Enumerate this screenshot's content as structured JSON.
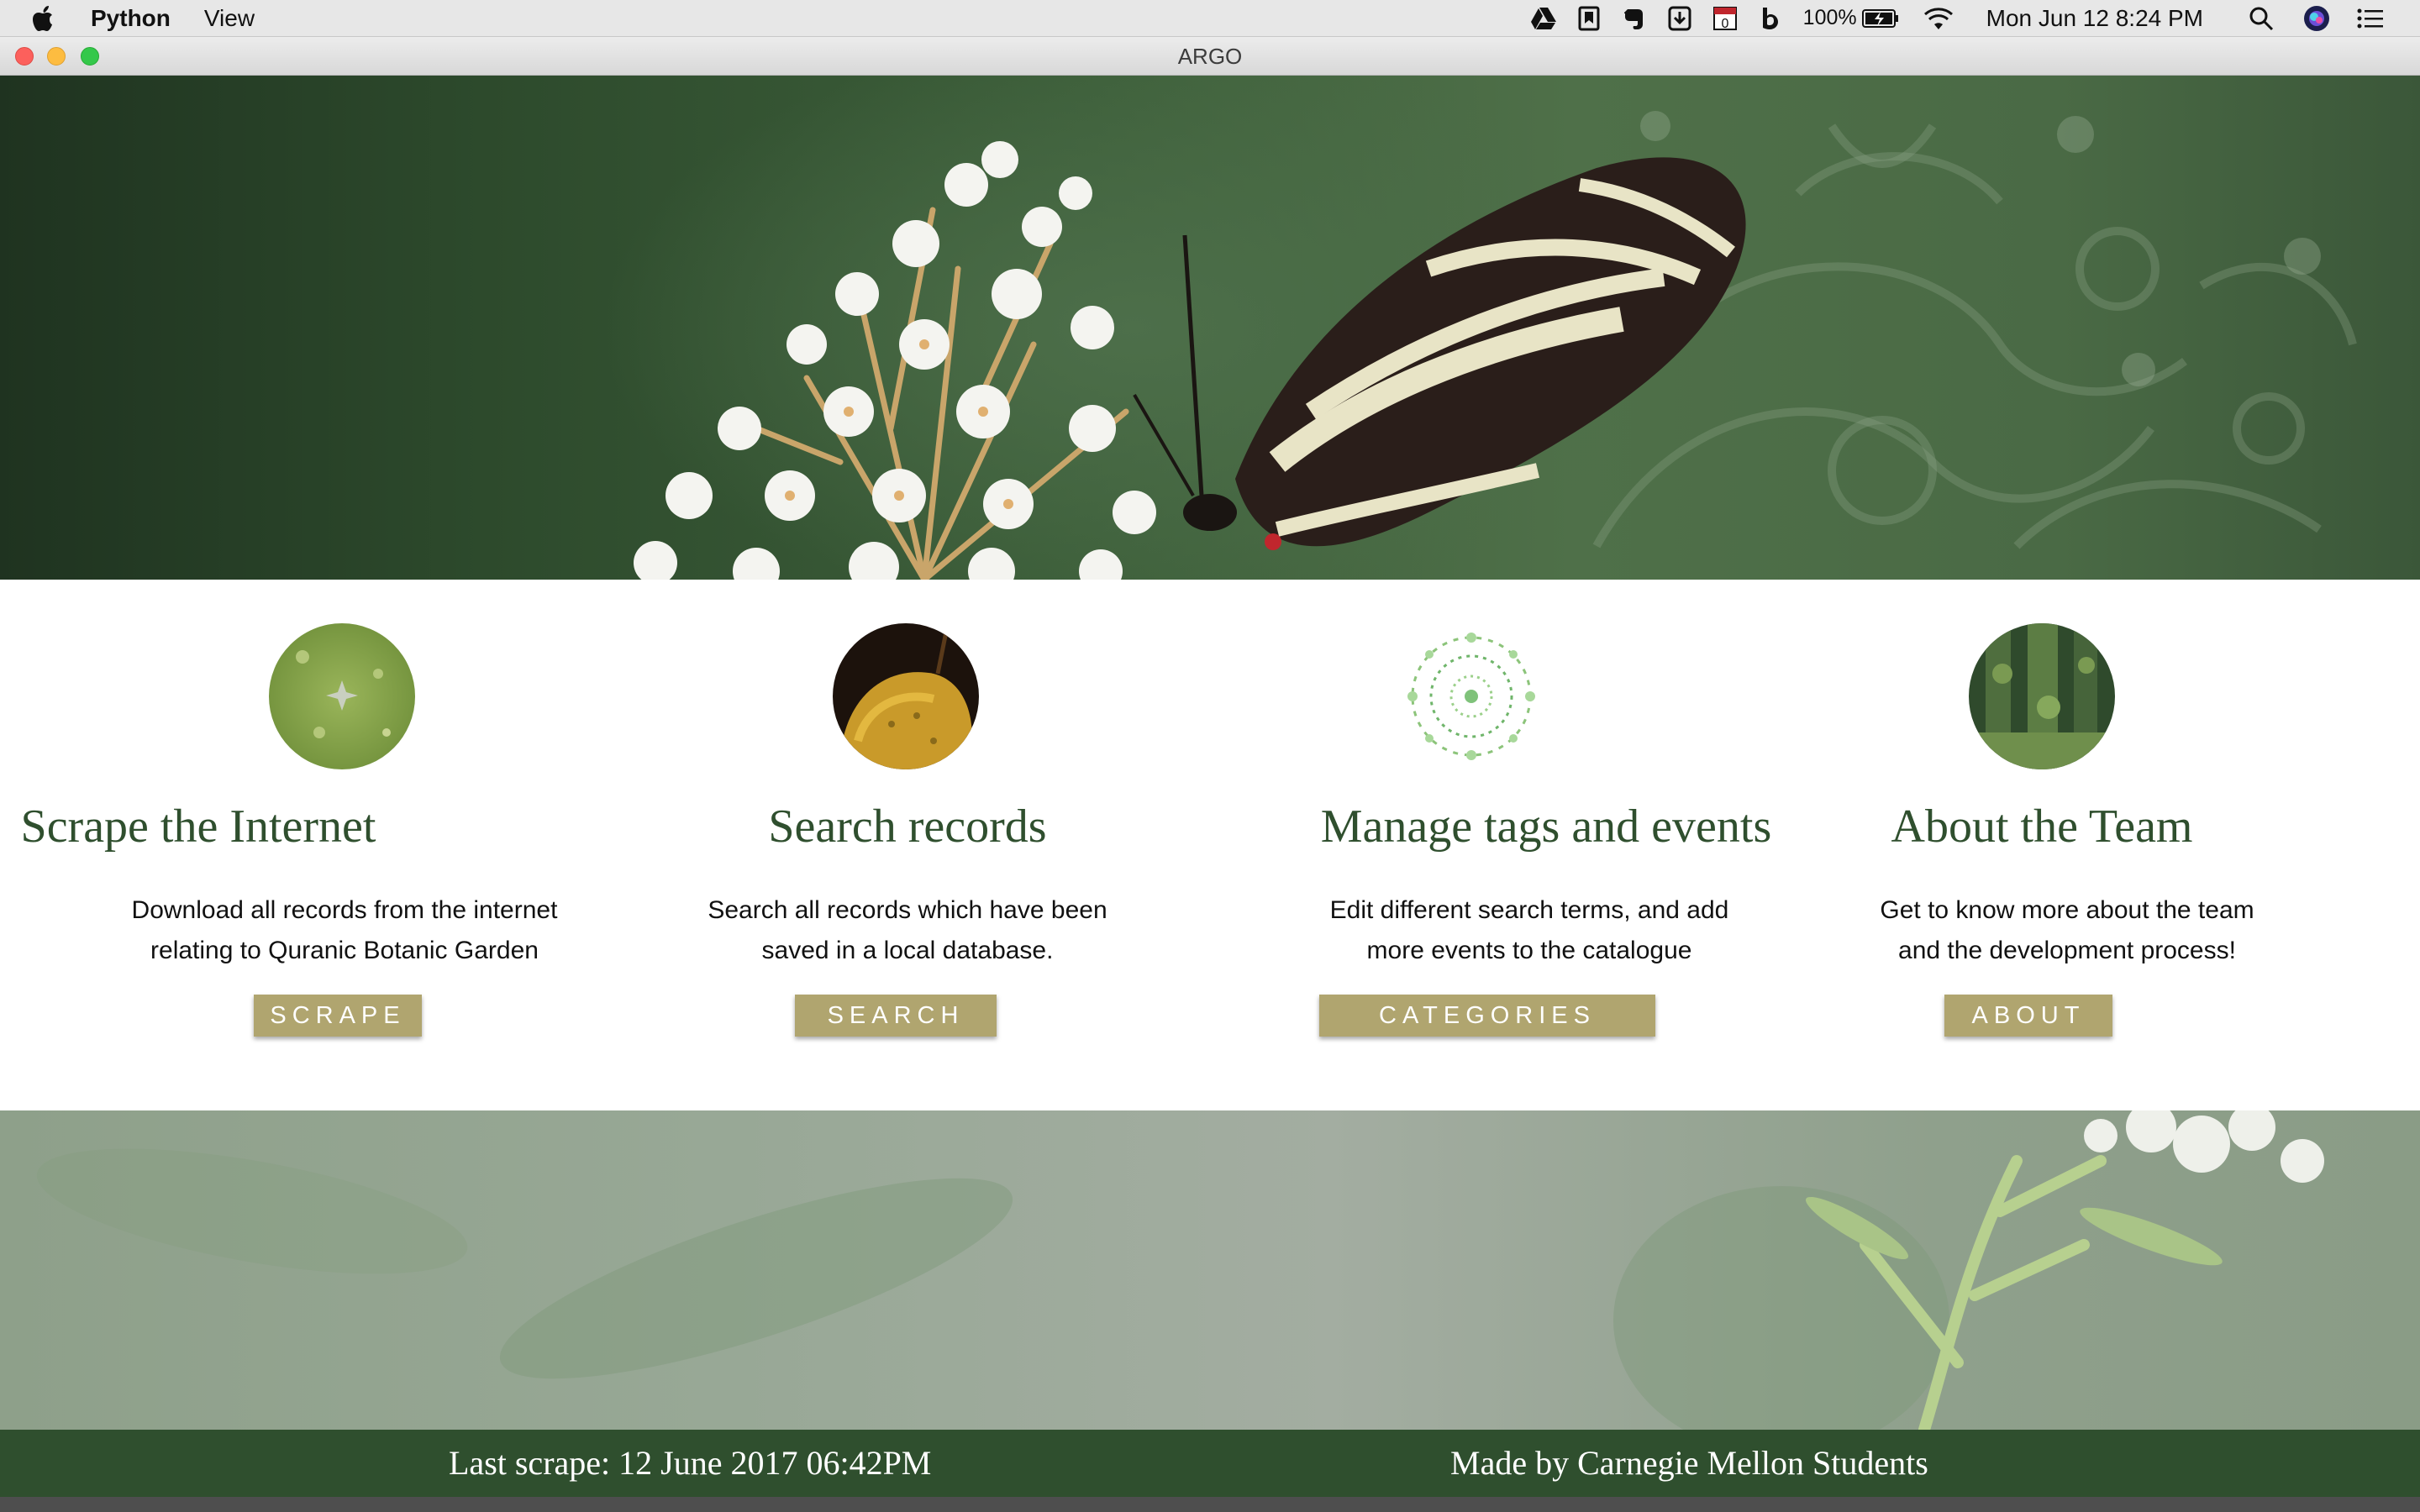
{
  "menubar": {
    "app_name": "Python",
    "menus": [
      "View"
    ],
    "status_icons": [
      "google-drive-icon",
      "bookmark-icon",
      "evernote-icon",
      "download-icon",
      "calendar-icon",
      "b-icon"
    ],
    "calendar_day": "0",
    "battery_percent": "100%",
    "clock": "Mon Jun 12  8:24 PM"
  },
  "window": {
    "title": "ARGO"
  },
  "features": [
    {
      "title": "Scrape the Internet",
      "desc_line1": "Download all records from the internet",
      "desc_line2": "relating to Quranic Botanic Garden",
      "button": "SCRAPE",
      "icon": "leaf-thumbnail"
    },
    {
      "title": "Search records",
      "desc_line1": "Search all records which have been",
      "desc_line2": "saved in a local database.",
      "button": "SEARCH",
      "icon": "fruit-thumbnail"
    },
    {
      "title": "Manage tags and events",
      "desc_line1": "Edit different search terms, and add",
      "desc_line2": "more events to the catalogue",
      "button": "CATEGORIES",
      "icon": "floral-wreath-thumbnail"
    },
    {
      "title": "About the Team",
      "desc_line1": "Get to know more about the team",
      "desc_line2": "and the development process!",
      "button": "ABOUT",
      "icon": "forest-thumbnail"
    }
  ],
  "footer": {
    "last_scrape": "Last scrape: 12 June 2017 06:42PM",
    "credits": "Made by Carnegie Mellon Students"
  },
  "colors": {
    "accent_green": "#2f4f2e",
    "button_gold": "#b0a56f"
  }
}
